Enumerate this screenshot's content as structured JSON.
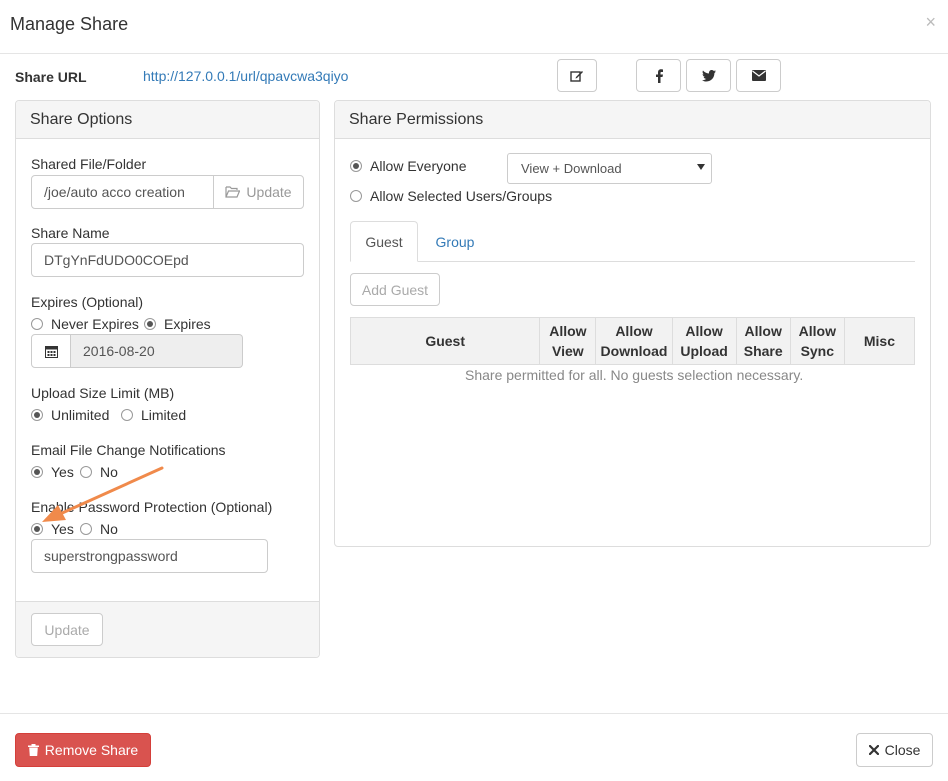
{
  "modal": {
    "title": "Manage Share",
    "close_glyph": "×"
  },
  "share_url": {
    "label": "Share URL",
    "url": "http://127.0.0.1/url/qpavcwa3qiyo"
  },
  "icons": {
    "edit": "edit-icon",
    "facebook": "facebook-icon",
    "twitter": "twitter-icon",
    "email": "envelope-icon"
  },
  "options": {
    "heading": "Share Options",
    "shared_file_label": "Shared File/Folder",
    "shared_file_value": "/joe/auto acco creation",
    "shared_file_button": "Update",
    "share_name_label": "Share Name",
    "share_name_value": "DTgYnFdUDO0COEpd",
    "expires_label": "Expires (Optional)",
    "expires_never": "Never Expires",
    "expires_yes": "Expires",
    "expires_date": "2016-08-20",
    "upload_label": "Upload Size Limit (MB)",
    "upload_unlimited": "Unlimited",
    "upload_limited": "Limited",
    "email_label": "Email File Change Notifications",
    "email_yes": "Yes",
    "email_no": "No",
    "password_label": "Enable Password Protection (Optional)",
    "password_yes": "Yes",
    "password_no": "No",
    "password_value": "superstrongpassword",
    "update_button": "Update"
  },
  "permissions": {
    "heading": "Share Permissions",
    "allow_everyone": "Allow Everyone",
    "allow_selected": "Allow Selected Users/Groups",
    "select_value": "View + Download",
    "tabs": [
      "Guest",
      "Group"
    ],
    "add_guest": "Add Guest",
    "columns": [
      "Guest",
      "Allow View",
      "Allow Download",
      "Allow Upload",
      "Allow Share",
      "Allow Sync",
      "Misc"
    ],
    "empty_message": "Share permitted for all. No guests selection necessary."
  },
  "footer": {
    "remove_label": "Remove Share",
    "close_label": "Close"
  },
  "colors": {
    "link": "#337ab7",
    "danger": "#d9534f",
    "arrow": "#f08a4b"
  }
}
